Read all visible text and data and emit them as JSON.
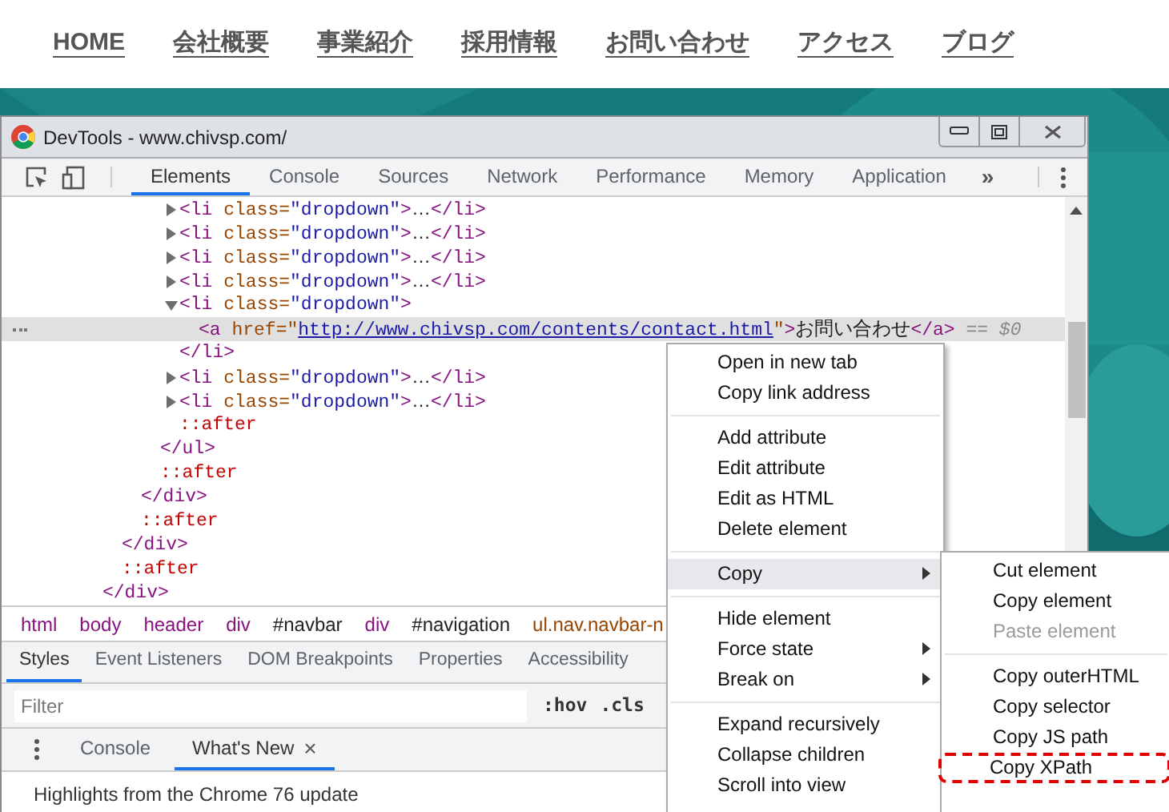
{
  "site_nav": {
    "links": [
      "HOME",
      "会社概要",
      "事業紹介",
      "採用情報",
      "お問い合わせ",
      "アクセス",
      "ブログ"
    ]
  },
  "window": {
    "title": "DevTools - www.chivsp.com/"
  },
  "tabs": [
    {
      "label": "Elements",
      "selected": true
    },
    {
      "label": "Console",
      "selected": false
    },
    {
      "label": "Sources",
      "selected": false
    },
    {
      "label": "Network",
      "selected": false
    },
    {
      "label": "Performance",
      "selected": false
    },
    {
      "label": "Memory",
      "selected": false
    },
    {
      "label": "Application",
      "selected": false
    }
  ],
  "more_tabs": "»",
  "dom_tree": [
    {
      "selected": false,
      "close": [
        {
          "kind": "tag",
          "text": "</div>"
        }
      ],
      "children": [
        {
          "selected": false,
          "close": [
            {
              "kind": "tag",
              "text": "</div>"
            }
          ],
          "children": [
            {
              "selected": false,
              "close": [
                {
                  "kind": "tag",
                  "text": "</div>"
                }
              ],
              "children": [
                {
                  "selected": false,
                  "close": [
                    {
                      "kind": "tag",
                      "text": "</ul>"
                    }
                  ],
                  "children": [
                    {
                      "selected": false,
                      "expanded": false,
                      "line": [
                        {
                          "kind": "tag",
                          "text": "<li "
                        },
                        {
                          "kind": "attr",
                          "text": "class"
                        },
                        {
                          "kind": "punct",
                          "text": "="
                        },
                        {
                          "kind": "value",
                          "text": "\"dropdown\""
                        },
                        {
                          "kind": "tag",
                          "text": ">"
                        },
                        {
                          "kind": "text",
                          "text": "…"
                        },
                        {
                          "kind": "tag",
                          "text": "</li>"
                        }
                      ]
                    },
                    {
                      "selected": false,
                      "expanded": false,
                      "line": [
                        {
                          "kind": "tag",
                          "text": "<li "
                        },
                        {
                          "kind": "attr",
                          "text": "class"
                        },
                        {
                          "kind": "punct",
                          "text": "="
                        },
                        {
                          "kind": "value",
                          "text": "\"dropdown\""
                        },
                        {
                          "kind": "tag",
                          "text": ">"
                        },
                        {
                          "kind": "text",
                          "text": "…"
                        },
                        {
                          "kind": "tag",
                          "text": "</li>"
                        }
                      ]
                    },
                    {
                      "selected": false,
                      "expanded": false,
                      "line": [
                        {
                          "kind": "tag",
                          "text": "<li "
                        },
                        {
                          "kind": "attr",
                          "text": "class"
                        },
                        {
                          "kind": "punct",
                          "text": "="
                        },
                        {
                          "kind": "value",
                          "text": "\"dropdown\""
                        },
                        {
                          "kind": "tag",
                          "text": ">"
                        },
                        {
                          "kind": "text",
                          "text": "…"
                        },
                        {
                          "kind": "tag",
                          "text": "</li>"
                        }
                      ]
                    },
                    {
                      "selected": false,
                      "expanded": false,
                      "line": [
                        {
                          "kind": "tag",
                          "text": "<li "
                        },
                        {
                          "kind": "attr",
                          "text": "class"
                        },
                        {
                          "kind": "punct",
                          "text": "="
                        },
                        {
                          "kind": "value",
                          "text": "\"dropdown\""
                        },
                        {
                          "kind": "tag",
                          "text": ">"
                        },
                        {
                          "kind": "text",
                          "text": "…"
                        },
                        {
                          "kind": "tag",
                          "text": "</li>"
                        }
                      ]
                    },
                    {
                      "selected": false,
                      "expanded": true,
                      "line": [
                        {
                          "kind": "tag",
                          "text": "<li "
                        },
                        {
                          "kind": "attr",
                          "text": "class"
                        },
                        {
                          "kind": "punct",
                          "text": "="
                        },
                        {
                          "kind": "value",
                          "text": "\"dropdown\""
                        },
                        {
                          "kind": "tag",
                          "text": ">"
                        }
                      ],
                      "close": [
                        {
                          "kind": "tag",
                          "text": "</li>"
                        }
                      ],
                      "children": [
                        {
                          "selected": true,
                          "line": [
                            {
                              "kind": "tag",
                              "text": "<a "
                            },
                            {
                              "kind": "attr",
                              "text": "href"
                            },
                            {
                              "kind": "punct",
                              "text": "=\""
                            },
                            {
                              "kind": "link",
                              "text": "http://www.chivsp.com/contents/contact.html"
                            },
                            {
                              "kind": "punct",
                              "text": "\""
                            },
                            {
                              "kind": "tag",
                              "text": ">"
                            },
                            {
                              "kind": "text",
                              "text": "お問い合わせ"
                            },
                            {
                              "kind": "tag",
                              "text": "</a>"
                            },
                            {
                              "kind": "comment",
                              "text": " == $0"
                            }
                          ]
                        }
                      ]
                    },
                    {
                      "selected": false,
                      "expanded": false,
                      "line": [
                        {
                          "kind": "tag",
                          "text": "<li "
                        },
                        {
                          "kind": "attr",
                          "text": "class"
                        },
                        {
                          "kind": "punct",
                          "text": "="
                        },
                        {
                          "kind": "value",
                          "text": "\"dropdown\""
                        },
                        {
                          "kind": "tag",
                          "text": ">"
                        },
                        {
                          "kind": "text",
                          "text": "…"
                        },
                        {
                          "kind": "tag",
                          "text": "</li>"
                        }
                      ]
                    },
                    {
                      "selected": false,
                      "expanded": false,
                      "line": [
                        {
                          "kind": "tag",
                          "text": "<li "
                        },
                        {
                          "kind": "attr",
                          "text": "class"
                        },
                        {
                          "kind": "punct",
                          "text": "="
                        },
                        {
                          "kind": "value",
                          "text": "\"dropdown\""
                        },
                        {
                          "kind": "tag",
                          "text": ">"
                        },
                        {
                          "kind": "text",
                          "text": "…"
                        },
                        {
                          "kind": "tag",
                          "text": "</li>"
                        }
                      ]
                    },
                    {
                      "selected": false,
                      "line": [
                        {
                          "kind": "pseudo",
                          "text": "::after"
                        }
                      ]
                    }
                  ]
                },
                {
                  "selected": false,
                  "line": [
                    {
                      "kind": "pseudo",
                      "text": "::after"
                    }
                  ]
                }
              ]
            },
            {
              "selected": false,
              "line": [
                {
                  "kind": "pseudo",
                  "text": "::after"
                }
              ]
            }
          ]
        },
        {
          "selected": false,
          "line": [
            {
              "kind": "pseudo",
              "text": "::after"
            }
          ]
        }
      ]
    }
  ],
  "breadcrumbs": [
    {
      "kind": "tag",
      "text": "html"
    },
    {
      "kind": "tag",
      "text": "body"
    },
    {
      "kind": "tag",
      "text": "header"
    },
    {
      "kind": "tag",
      "text": "div"
    },
    {
      "kind": "id",
      "text": "#navbar"
    },
    {
      "kind": "tag",
      "text": "div"
    },
    {
      "kind": "id",
      "text": "#navigation"
    },
    {
      "kind": "class",
      "text": "ul.nav.navbar-n"
    }
  ],
  "style_tabs": [
    {
      "label": "Styles",
      "selected": true
    },
    {
      "label": "Event Listeners",
      "selected": false
    },
    {
      "label": "DOM Breakpoints",
      "selected": false
    },
    {
      "label": "Properties",
      "selected": false
    },
    {
      "label": "Accessibility",
      "selected": false
    }
  ],
  "filter": {
    "placeholder": "Filter",
    "hov": ":hov",
    "cls": ".cls"
  },
  "drawer": {
    "tabs": [
      {
        "label": "Console",
        "selected": false,
        "closable": false
      },
      {
        "label": "What's New",
        "selected": true,
        "closable": true
      }
    ],
    "close_glyph": "×",
    "text": "Highlights from the Chrome 76 update"
  },
  "context_menu": {
    "groups": [
      [
        {
          "label": "Open in new tab",
          "selected": false,
          "has_submenu": false
        },
        {
          "label": "Copy link address",
          "selected": false,
          "has_submenu": false
        }
      ],
      [
        {
          "label": "Add attribute",
          "selected": false,
          "has_submenu": false
        },
        {
          "label": "Edit attribute",
          "selected": false,
          "has_submenu": false
        },
        {
          "label": "Edit as HTML",
          "selected": false,
          "has_submenu": false
        },
        {
          "label": "Delete element",
          "selected": false,
          "has_submenu": false
        }
      ],
      [
        {
          "label": "Copy",
          "selected": true,
          "has_submenu": true
        }
      ],
      [
        {
          "label": "Hide element",
          "selected": false,
          "has_submenu": false
        },
        {
          "label": "Force state",
          "selected": false,
          "has_submenu": true
        },
        {
          "label": "Break on",
          "selected": false,
          "has_submenu": true
        }
      ],
      [
        {
          "label": "Expand recursively",
          "selected": false,
          "has_submenu": false
        },
        {
          "label": "Collapse children",
          "selected": false,
          "has_submenu": false
        },
        {
          "label": "Scroll into view",
          "selected": false,
          "has_submenu": false
        }
      ]
    ]
  },
  "copy_submenu": {
    "groups": [
      [
        {
          "label": "Cut element",
          "disabled": false,
          "annotated": false
        },
        {
          "label": "Copy element",
          "disabled": false,
          "annotated": false
        },
        {
          "label": "Paste element",
          "disabled": true,
          "annotated": false
        }
      ],
      [
        {
          "label": "Copy outerHTML",
          "disabled": false,
          "annotated": false
        },
        {
          "label": "Copy selector",
          "disabled": false,
          "annotated": false
        },
        {
          "label": "Copy JS path",
          "disabled": false,
          "annotated": false
        },
        {
          "label": "Copy XPath",
          "disabled": false,
          "annotated": true
        }
      ]
    ]
  }
}
